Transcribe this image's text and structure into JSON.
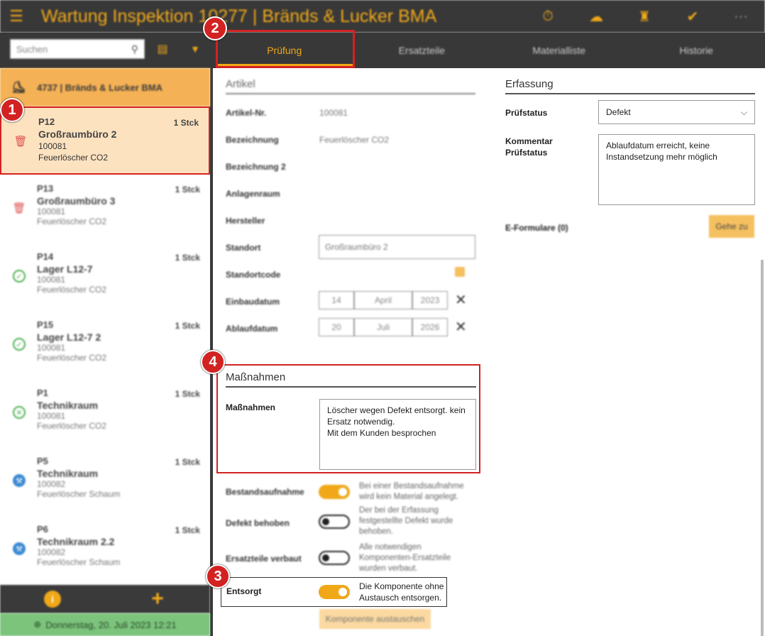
{
  "app": {
    "title": "Wartung Inspektion 10277 | Bränds & Lucker BMA",
    "actions": [
      {
        "icon": "timer-icon",
        "glyph": "⏱"
      },
      {
        "icon": "cloud-icon",
        "glyph": "☁"
      },
      {
        "icon": "building-icon",
        "glyph": "♜"
      },
      {
        "icon": "check-icon",
        "glyph": "✔"
      },
      {
        "icon": "more-icon",
        "glyph": "⋯"
      }
    ],
    "accent": "#f0a818"
  },
  "search": {
    "placeholder": "Suchen"
  },
  "tabs": [
    "Prüfung",
    "Ersatzteile",
    "Materialliste",
    "Historie"
  ],
  "sidebar": {
    "customer": "4737 | Bränds & Lucker BMA",
    "items": [
      {
        "code": "P12",
        "name": "Großraumbüro 2",
        "qty": "1 Stck",
        "num": "100081",
        "type": "Feuerlöscher CO2",
        "status": "trash"
      },
      {
        "code": "P13",
        "name": "Großraumbüro 3",
        "qty": "1 Stck",
        "num": "100081",
        "type": "Feuerlöscher CO2",
        "status": "trash"
      },
      {
        "code": "P14",
        "name": "Lager L12-7",
        "qty": "1 Stck",
        "num": "100081",
        "type": "Feuerlöscher CO2",
        "status": "ok"
      },
      {
        "code": "P15",
        "name": "Lager L12-7 2",
        "qty": "1 Stck",
        "num": "100081",
        "type": "Feuerlöscher CO2",
        "status": "ok"
      },
      {
        "code": "P1",
        "name": "Technikraum",
        "qty": "1 Stck",
        "num": "100081",
        "type": "Feuerlöscher CO2",
        "status": "bad"
      },
      {
        "code": "P5",
        "name": "Technikraum",
        "qty": "1 Stck",
        "num": "100082",
        "type": "Feuerlöscher Schaum",
        "status": "blue"
      },
      {
        "code": "P6",
        "name": "Technikraum 2.2",
        "qty": "1 Stck",
        "num": "100082",
        "type": "Feuerlöscher Schaum",
        "status": "blue"
      }
    ],
    "date": "Donnerstag, 20. Juli 2023 12:21"
  },
  "artikel": {
    "header": "Artikel",
    "labels": {
      "nr": "Artikel-Nr.",
      "bez": "Bezeichnung",
      "bez2": "Bezeichnung 2",
      "raum": "Anlagenraum",
      "hersteller": "Hersteller",
      "standort": "Standort",
      "code": "Standortcode",
      "einbau": "Einbaudatum",
      "ablauf": "Ablaufdatum"
    },
    "nr": "100081",
    "bez": "Feuerlöscher CO2",
    "standort": "Großraumbüro 2",
    "einbau": {
      "day": "14",
      "month": "April",
      "year": "2023"
    },
    "ablauf": {
      "day": "20",
      "month": "Juli",
      "year": "2026"
    }
  },
  "erfassung": {
    "header": "Erfassung",
    "pruefstatus_label": "Prüfstatus",
    "pruefstatus": "Defekt",
    "kommentar_label1": "Kommentar",
    "kommentar_label2": "Prüfstatus",
    "kommentar": "Ablaufdatum erreicht, keine Instandsetzung mehr möglich",
    "eformulare_label": "E-Formulare (0)",
    "gehe_zu": "Gehe zu"
  },
  "massnahmen": {
    "header": "Maßnahmen",
    "label": "Maßnahmen",
    "text1": "Löscher wegen Defekt entsorgt. kein",
    "text2": "Ersatz notwendig.",
    "text3": "Mit dem Kunden besprochen"
  },
  "toggles": {
    "bestand": {
      "label": "Bestandsaufnahme",
      "on": true,
      "desc": "Bei einer Bestandsaufnahme wird kein Material angelegt."
    },
    "defekt": {
      "label": "Defekt behoben",
      "on": false,
      "desc": "Der bei der Erfassung festgestellte Defekt wurde behoben."
    },
    "ersatz": {
      "label": "Ersatzteile verbaut",
      "on": false,
      "desc": "Alle notwendigen Komponenten-Ersatzteile wurden verbaut."
    },
    "entsorgt": {
      "label": "Entsorgt",
      "on": true,
      "desc1": "Die Komponente ohne",
      "desc2": "Austausch entsorgen."
    }
  },
  "komponente_btn": "Komponente austauschen",
  "callouts": [
    "1",
    "2",
    "3",
    "4"
  ]
}
